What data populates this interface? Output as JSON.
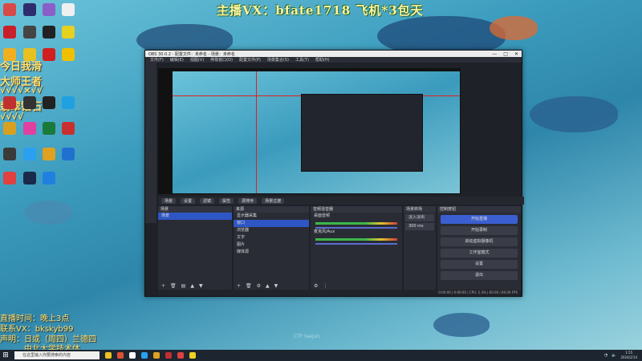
{
  "overlay": {
    "title": "主播VX：bfate1718  飞机*3包天",
    "left_lines": [
      "今日我滑",
      "大师王者",
      "√√√√×√√",
      "翡翠钻石",
      "√√√√"
    ],
    "bottom_lines": [
      "直播时间：晚上3点",
      "联系VX：bkskyb99",
      "声明：日或（周四）兰德四",
      "  中北大学技术体"
    ],
    "watermark": "CTF taejun"
  },
  "desktop_icons": [
    {
      "name": "app-icon",
      "color": "#d84a4a"
    },
    {
      "name": "app-icon",
      "color": "#2e2e6e"
    },
    {
      "name": "app-icon",
      "color": "#8a5fc8"
    },
    {
      "name": "app-icon",
      "color": "#f0f0f0"
    },
    {
      "name": "app-icon",
      "color": "#c8202a"
    },
    {
      "name": "app-icon",
      "color": "#444"
    },
    {
      "name": "app-icon",
      "color": "#222"
    },
    {
      "name": "app-icon",
      "color": "#e6d020"
    },
    {
      "name": "app-icon",
      "color": "#f2b020"
    },
    {
      "name": "app-icon",
      "color": "#e8c020"
    },
    {
      "name": "app-icon",
      "color": "#d02020"
    },
    {
      "name": "app-icon",
      "color": "#f0c000"
    },
    {
      "name": "app-icon",
      "color": "#c03030"
    },
    {
      "name": "app-icon",
      "color": "#333"
    },
    {
      "name": "app-icon",
      "color": "#222"
    },
    {
      "name": "app-icon",
      "color": "#20a0e0"
    },
    {
      "name": "app-icon",
      "color": "#d8a020"
    },
    {
      "name": "app-icon",
      "color": "#e040a0"
    },
    {
      "name": "app-icon",
      "color": "#1a7a3a"
    },
    {
      "name": "app-icon",
      "color": "#c83030"
    },
    {
      "name": "app-icon",
      "color": "#3a3a3a"
    },
    {
      "name": "app-icon",
      "color": "#2aa0f0"
    },
    {
      "name": "app-icon",
      "color": "#e0a020"
    },
    {
      "name": "app-icon",
      "color": "#2070d0"
    },
    {
      "name": "app-icon",
      "color": "#e04040"
    },
    {
      "name": "app-icon",
      "color": "#1a2a4a"
    },
    {
      "name": "app-icon",
      "color": "#2080e0"
    }
  ],
  "obs": {
    "title": "OBS 30.0.2 - 配置文件：未命名 - 场景：未命名",
    "menu": [
      "文件(F)",
      "编辑(E)",
      "视图(V)",
      "停靠窗口(D)",
      "配置文件(P)",
      "场景集合(S)",
      "工具(T)",
      "帮助(H)"
    ],
    "scene_bar": [
      "场景",
      "设置",
      "滤镜",
      "属性",
      "源排序",
      "场景过渡"
    ],
    "scenes_title": "场景",
    "scenes": [
      "场景"
    ],
    "sources_title": "来源",
    "sources": [
      "显示器采集",
      "窗口",
      "浏览器",
      "文字",
      "图片",
      "媒体源"
    ],
    "mixer_title": "音频混音器",
    "mixer_tracks": [
      "桌面音频",
      "麦克风/Aux"
    ],
    "transitions_title": "场景转场",
    "transition_type": "淡入淡出",
    "transition_duration": "300 ms",
    "controls_title": "控制按钮",
    "controls": [
      "开始直播",
      "开始录制",
      "启动虚拟摄像机",
      "工作室模式",
      "设置",
      "退出"
    ],
    "status": "0:00:00 | 0:00:00 | CPU: 2.3% | 60.00 / 60.00 FPS"
  },
  "taskbar": {
    "start": "⊞",
    "search_placeholder": "在这里输入你要搜索的内容",
    "time": "1:55",
    "date": "2024/2/14",
    "icons": [
      "#f0c020",
      "#e05030",
      "#ffffff",
      "#2aa0f0",
      "#e0a020",
      "#c03030",
      "#e04040",
      "#f0d020"
    ]
  },
  "colors": {
    "accent": "#3b5fd0",
    "panel": "#2a2c35",
    "title_yellow": "#fff4a0"
  }
}
